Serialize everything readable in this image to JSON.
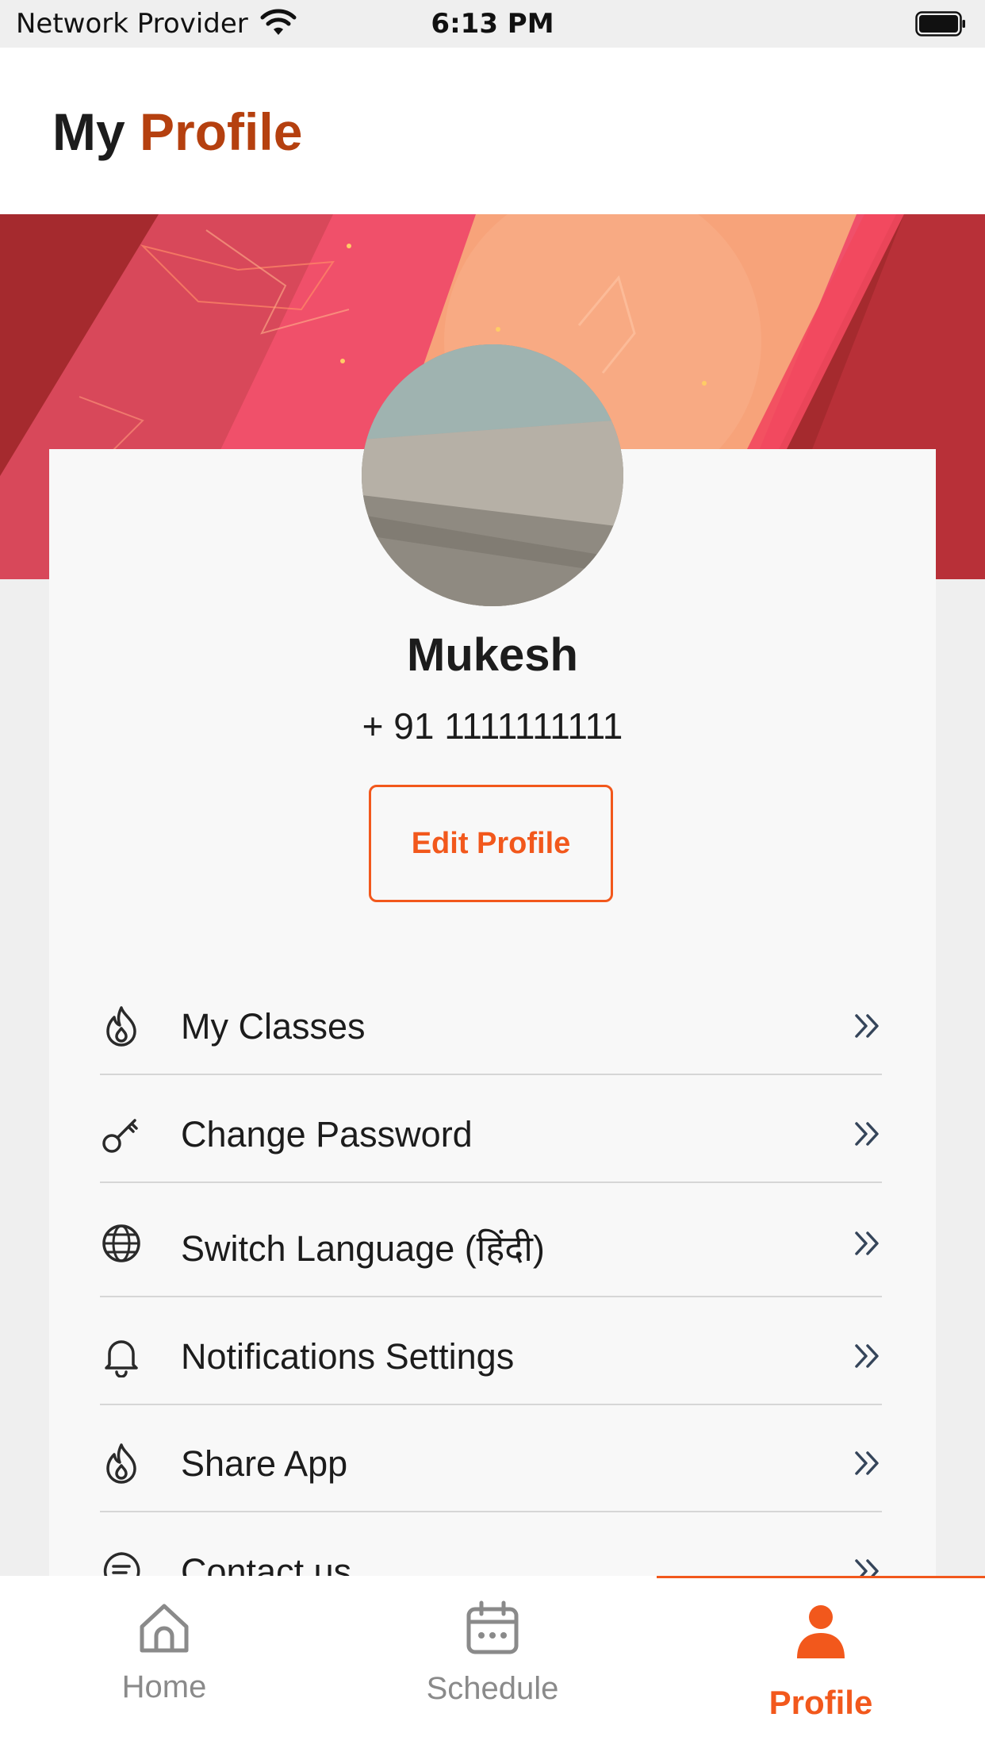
{
  "status_bar": {
    "carrier": "Network Provider",
    "time": "6:13 PM",
    "wifi_icon": "wifi-icon",
    "battery_icon": "battery-icon"
  },
  "header": {
    "title_part1": "My",
    "title_part2": "Profile"
  },
  "profile": {
    "name": "Mukesh",
    "phone": "+ 91 1111111111",
    "edit_label": "Edit Profile"
  },
  "menu": {
    "items": [
      {
        "label": "My Classes",
        "icon": "flame-icon"
      },
      {
        "label": "Change Password",
        "icon": "key-icon"
      },
      {
        "label": "Switch Language (हिंदी)",
        "icon": "globe-icon"
      },
      {
        "label": "Notifications Settings",
        "icon": "bell-icon"
      },
      {
        "label": "Share App",
        "icon": "flame-icon"
      },
      {
        "label": "Contact us",
        "icon": "message-icon"
      }
    ]
  },
  "tabs": [
    {
      "label": "Home",
      "icon": "home-icon",
      "active": false
    },
    {
      "label": "Schedule",
      "icon": "calendar-icon",
      "active": false
    },
    {
      "label": "Profile",
      "icon": "person-icon",
      "active": true
    }
  ],
  "colors": {
    "accent": "#f2581c",
    "title_accent": "#b5400f",
    "banner_dark": "#a52a2e",
    "banner_pink": "#f0506a",
    "banner_peach": "#f7a37a"
  }
}
